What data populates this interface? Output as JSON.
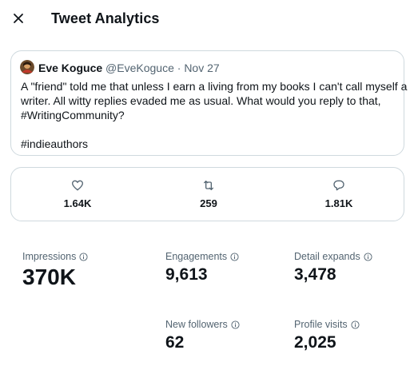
{
  "header": {
    "close_icon": "close-icon",
    "title": "Tweet Analytics"
  },
  "tweet": {
    "avatar_icon": "avatar",
    "author_name": "Eve Koguce",
    "author_handle": "@EveKoguce",
    "separator": "·",
    "date": "Nov 27",
    "text_lines": [
      "A \"friend\" told me that unless I earn a living from my books I can't call myself a",
      "writer. All witty replies evaded me as usual. What would you reply to that,",
      "#WritingCommunity?",
      "#indieauthors"
    ]
  },
  "engagement": {
    "likes": {
      "icon": "heart-icon",
      "value": "1.64K"
    },
    "retweets": {
      "icon": "retweet-icon",
      "value": "259"
    },
    "replies": {
      "icon": "reply-icon",
      "value": "1.81K"
    }
  },
  "stats": {
    "impressions": {
      "label": "Impressions",
      "value": "370K"
    },
    "engagements": {
      "label": "Engagements",
      "value": "9,613"
    },
    "detail_expands": {
      "label": "Detail expands",
      "value": "3,478"
    },
    "new_followers": {
      "label": "New followers",
      "value": "62"
    },
    "profile_visits": {
      "label": "Profile visits",
      "value": "2,025"
    }
  },
  "colors": {
    "text_primary": "#0f1419",
    "text_secondary": "#536471",
    "border": "#cfd9de",
    "background": "#ffffff"
  }
}
